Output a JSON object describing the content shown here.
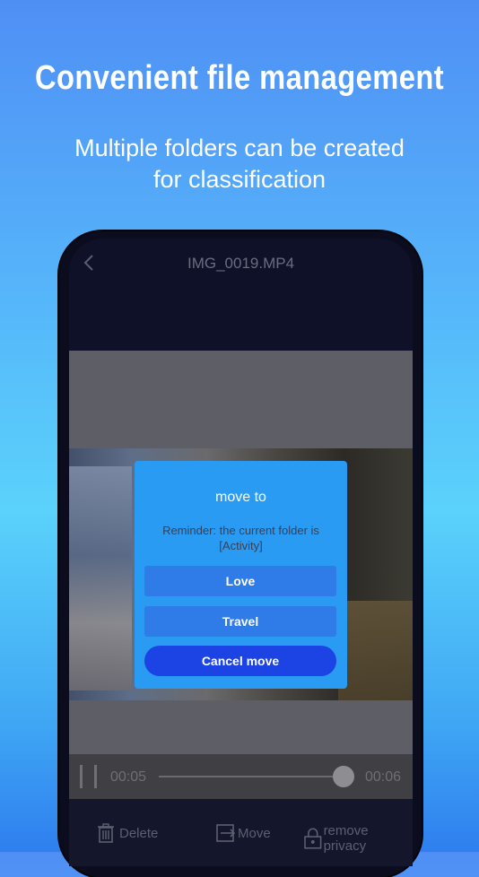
{
  "promo": {
    "headline": "Convenient file management",
    "sub_line1": "Multiple folders can be created",
    "sub_line2": "for classification"
  },
  "screen": {
    "title": "IMG_0019.MP4",
    "back_icon": "chevron-left-icon"
  },
  "player": {
    "current_time": "00:05",
    "total_time": "00:06",
    "progress": 0.83
  },
  "toolbar": {
    "delete_label": "Delete",
    "move_label": "Move",
    "privacy_label": "remove privacy"
  },
  "dialog": {
    "title": "move to",
    "note_line1": "Reminder: the current folder is",
    "note_line2": "[Activity]",
    "options": [
      "Love",
      "Travel"
    ],
    "cancel_label": "Cancel move"
  },
  "colors": {
    "dialog_bg": "#2a9bf3",
    "option_bg": "#2f7be8",
    "cancel_bg": "#1c43e4"
  }
}
